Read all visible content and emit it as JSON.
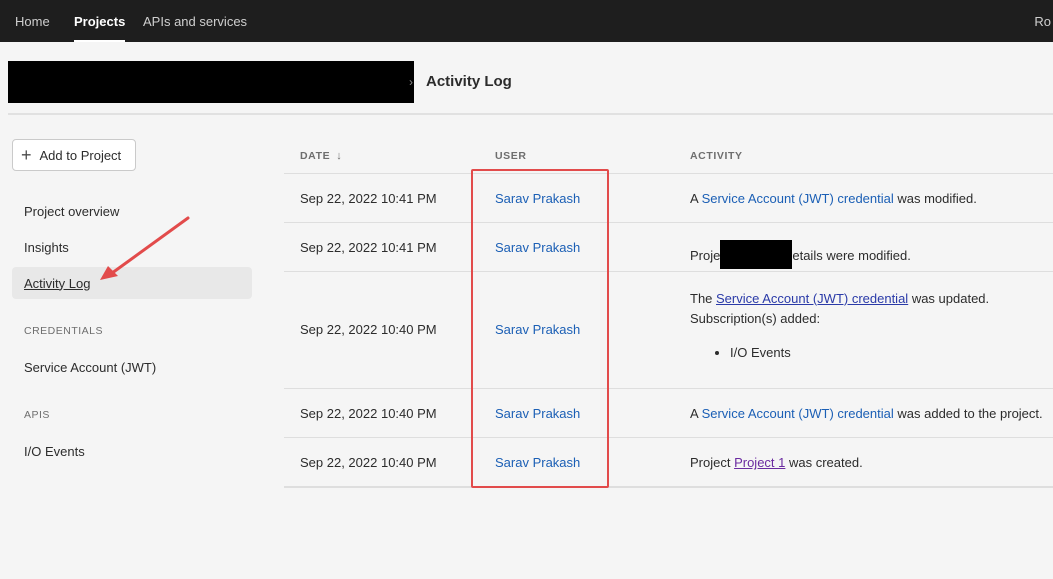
{
  "topnav": {
    "items": [
      {
        "label": "Home",
        "active": false
      },
      {
        "label": "Projects",
        "active": true
      },
      {
        "label": "APIs and services",
        "active": false
      }
    ],
    "user_initials": "Ro"
  },
  "breadcrumb": {
    "page_title": "Activity Log",
    "separator": "›"
  },
  "sidebar": {
    "add_button": "Add to Project",
    "nav": [
      {
        "label": "Project overview"
      },
      {
        "label": "Insights"
      },
      {
        "label": "Activity Log",
        "selected": true
      }
    ],
    "credentials_label": "CREDENTIALS",
    "credentials": [
      {
        "label": "Service Account (JWT)"
      }
    ],
    "apis_label": "APIS",
    "apis": [
      {
        "label": "I/O Events"
      }
    ]
  },
  "table": {
    "headers": {
      "date": "DATE",
      "user": "USER",
      "activity": "ACTIVITY"
    },
    "rows": [
      {
        "date": "Sep 22, 2022 10:41 PM",
        "user": "Sarav Prakash",
        "pre": "A ",
        "link": "Service Account (JWT) credential",
        "post": " was modified."
      },
      {
        "date": "Sep 22, 2022 10:41 PM",
        "user": "Sarav Prakash",
        "pre": "Proje",
        "post": "etails were modified."
      },
      {
        "date": "Sep 22, 2022 10:40 PM",
        "user": "Sarav Prakash",
        "pre": "The ",
        "link": "Service Account (JWT) credential",
        "post": " was updated.",
        "line2": "Subscription(s) added:",
        "bullet": "I/O Events"
      },
      {
        "date": "Sep 22, 2022 10:40 PM",
        "user": "Sarav Prakash",
        "pre": "A ",
        "link": "Service Account (JWT) credential",
        "post": " was added to the project."
      },
      {
        "date": "Sep 22, 2022 10:40 PM",
        "user": "Sarav Prakash",
        "pre": "Project ",
        "link": "Project 1",
        "post": " was created."
      }
    ]
  },
  "colors": {
    "link": "#1b5fb5",
    "annotation": "#e24b4b",
    "nav_bg": "#1e1e1e"
  }
}
